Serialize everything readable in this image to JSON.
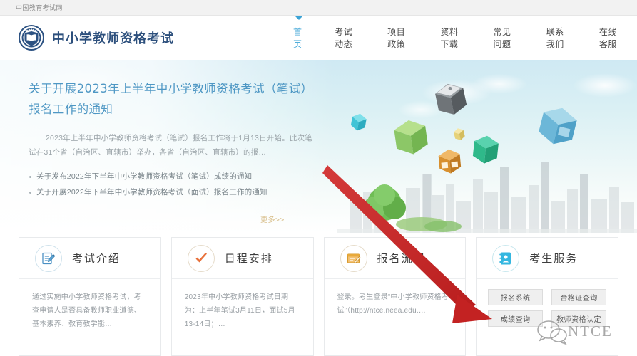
{
  "topbar": {
    "site_name": "中国教育考试网"
  },
  "header": {
    "brand_title": "中小学教师资格考试",
    "logo_icon": "book-shield-emblem-icon",
    "nav": [
      {
        "label": "首页",
        "active": true
      },
      {
        "label": "考试动态",
        "active": false
      },
      {
        "label": "项目政策",
        "active": false
      },
      {
        "label": "资料下载",
        "active": false
      },
      {
        "label": "常见问题",
        "active": false
      },
      {
        "label": "联系我们",
        "active": false
      },
      {
        "label": "在线客服",
        "active": false
      }
    ]
  },
  "banner": {
    "headline": "关于开展2023年上半年中小学教师资格考试（笔试）报名工作的通知",
    "summary": "2023年上半年中小学教师资格考试（笔试）报名工作将于1月13日开始。此次笔试在31个省（自治区、直辖市）举办，各省（自治区、直辖市）的报…",
    "links": [
      "关于发布2022年下半年中小学教师资格考试（笔试）成绩的通知",
      "关于开展2022年下半年中小学教师资格考试（面试）报名工作的通知"
    ],
    "more_label": "更多>>",
    "art": {
      "description": "sky-with-clouds-floating-cubes-tree-and-city-skyline",
      "cubes": [
        {
          "name": "cube-grey",
          "color": "#6f7276"
        },
        {
          "name": "cube-blue",
          "color": "#7ec0dd"
        },
        {
          "name": "cube-green",
          "color": "#8cc96b"
        },
        {
          "name": "cube-teal",
          "color": "#2fb98a"
        },
        {
          "name": "cube-orange",
          "color": "#e09a45"
        },
        {
          "name": "cube-cyan-small",
          "color": "#4ec8d8"
        },
        {
          "name": "cube-yellow-small",
          "color": "#e8d27a"
        }
      ]
    }
  },
  "cards": [
    {
      "title": "考试介绍",
      "icon": "document-pencil-icon",
      "icon_color": "#4a90c4",
      "desc": "通过实施中小学教师资格考试，考查申请人是否具备教师职业道德、基本素养、教育教学能…",
      "buttons": []
    },
    {
      "title": "日程安排",
      "icon": "checkmark-icon",
      "icon_color": "#e8703a",
      "desc": "2023年中小学教师资格考试日期为：上半年笔试3月11日，面试5月13-14日；…",
      "buttons": []
    },
    {
      "title": "报名流程",
      "icon": "form-pen-icon",
      "icon_color": "#e8a93a",
      "desc": "登录。考生登录“中小学教师资格考试”（http://ntce.neea.edu.…",
      "buttons": []
    },
    {
      "title": "考生服务",
      "icon": "id-card-icon",
      "icon_color": "#35b7e0",
      "desc": "",
      "buttons": [
        "报名系统",
        "合格证查询",
        "成绩查询",
        "教师资格认定"
      ]
    }
  ],
  "annotation": {
    "arrow_color": "#cc2222",
    "arrow_label": "red-pointer-arrow-to-registration-system"
  },
  "watermark": {
    "text": "NTCE",
    "icon": "wechat-chat-bubbles-icon"
  },
  "colors": {
    "accent": "#3ba3d6",
    "brand": "#2c4f7c",
    "banner_heading": "#4e97c4",
    "more_link": "#d8be8a"
  }
}
